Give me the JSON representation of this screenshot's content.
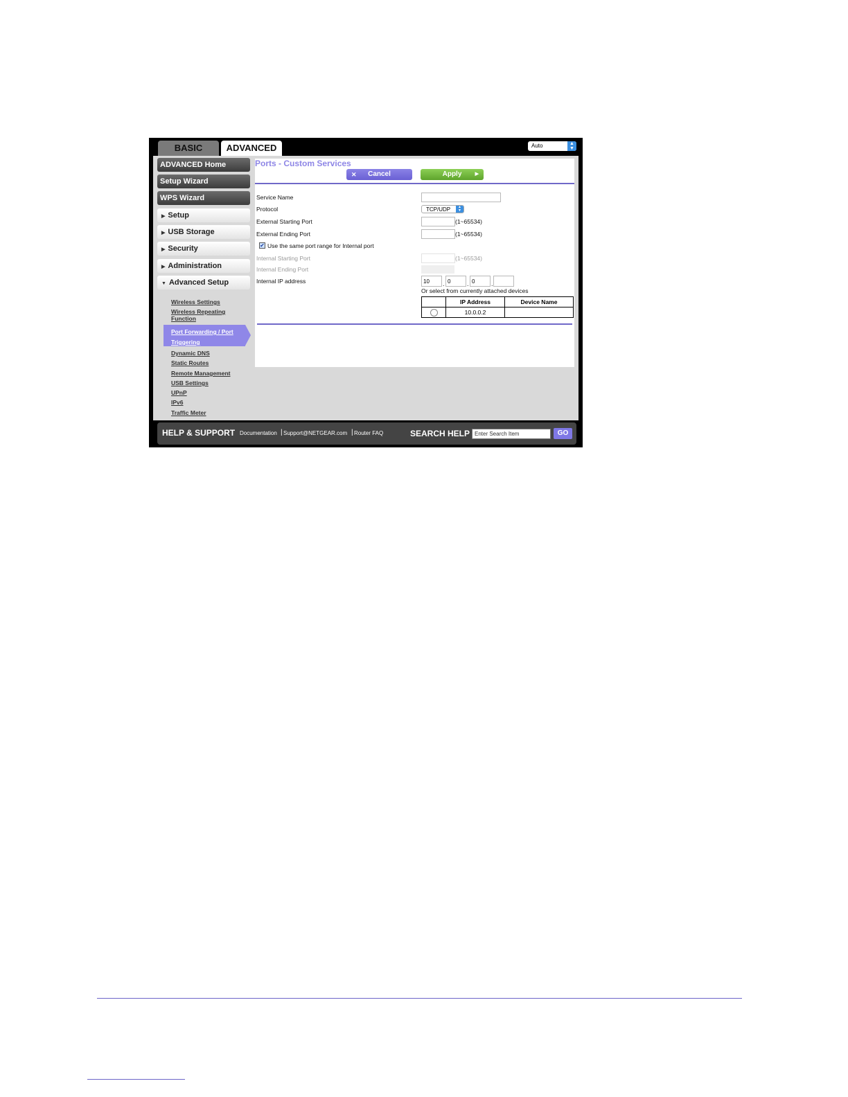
{
  "tabs": {
    "basic": "BASIC",
    "advanced": "ADVANCED"
  },
  "language_select": {
    "value": "Auto"
  },
  "nav": {
    "buttons": [
      "ADVANCED Home",
      "Setup Wizard",
      "WPS Wizard"
    ],
    "sections": [
      "Setup",
      "USB Storage",
      "Security",
      "Administration",
      "Advanced Setup"
    ],
    "advanced_setup_links": {
      "wireless_settings": "Wireless Settings",
      "wireless_repeating": "Wireless Repeating Function",
      "port_forwarding": "Port Forwarding / Port Triggering",
      "dynamic_dns": "Dynamic DNS",
      "static_routes": "Static Routes",
      "remote_management": "Remote Management",
      "usb_settings": "USB Settings",
      "upnp": "UPnP",
      "ipv6": "IPv6",
      "traffic_meter": "Traffic Meter"
    }
  },
  "page": {
    "title": "Ports - Custom Services",
    "cancel_label": "Cancel",
    "apply_label": "Apply"
  },
  "form": {
    "service_name_label": "Service Name",
    "service_name_value": "",
    "protocol_label": "Protocol",
    "protocol_value": "TCP/UDP",
    "ext_start_label": "External Starting Port",
    "ext_start_value": "",
    "ext_end_label": "External Ending Port",
    "ext_end_value": "",
    "port_range_hint": "(1~65534)",
    "same_range_label": "Use the same port range for Internal port",
    "same_range_checked": true,
    "int_start_label": "Internal Starting Port",
    "int_end_label": "Internal Ending Port",
    "int_ip_label": "Internal IP address",
    "ip_octets": [
      "10",
      "0",
      "0",
      ""
    ],
    "select_devices_text": "Or select from currently attached devices"
  },
  "devices_table": {
    "headers": [
      "",
      "IP Address",
      "Device Name"
    ],
    "rows": [
      {
        "ip": "10.0.0.2",
        "name": ""
      }
    ]
  },
  "footer": {
    "help_title": "HELP & SUPPORT",
    "links": [
      "Documentation",
      "Support@NETGEAR.com",
      "Router FAQ"
    ],
    "search_title": "SEARCH HELP",
    "search_value": "Enter Search Item",
    "go_label": "GO"
  }
}
